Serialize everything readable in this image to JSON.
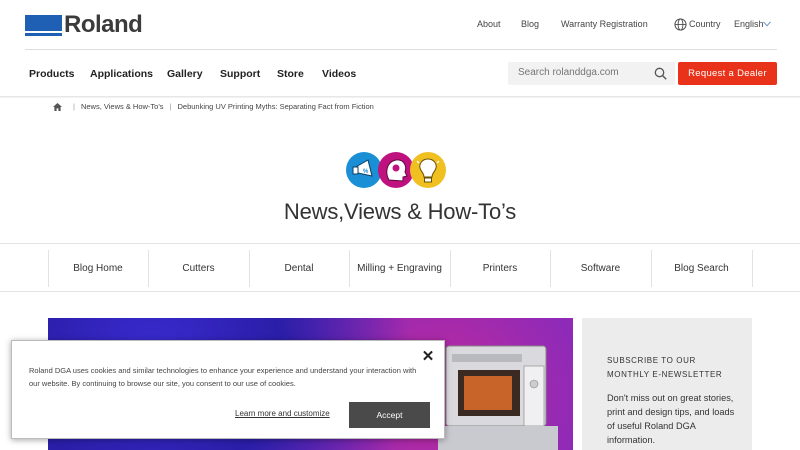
{
  "brand": {
    "name": "Roland",
    "color": "#1f5fb4"
  },
  "top_links": {
    "about": "About",
    "blog": "Blog",
    "warranty": "Warranty Registration",
    "country": "Country",
    "language": "English"
  },
  "nav": {
    "items": [
      "Products",
      "Applications",
      "Gallery",
      "Support",
      "Store",
      "Videos"
    ],
    "search_placeholder": "Search rolanddga.com",
    "dealer_button": "Request a Dealer",
    "dealer_color": "#e8331a"
  },
  "breadcrumb": {
    "items": [
      "News, Views & How-To's",
      "Debunking UV Printing Myths: Separating Fact from Fiction"
    ]
  },
  "hero": {
    "title": "News,Views & How-To’s",
    "icon_colors": [
      "#1b8fd6",
      "#c0127f",
      "#f0c020"
    ]
  },
  "categories": [
    "Blog Home",
    "Cutters",
    "Dental",
    "Milling + Engraving",
    "Printers",
    "Software",
    "Blog Search"
  ],
  "sidebar": {
    "heading": "SUBSCRIBE TO OUR MONTHLY E-NEWSLETTER",
    "body": "Don't miss out on great stories, print and design tips, and loads of useful Roland DGA information."
  },
  "cookie": {
    "text": "Roland DGA uses cookies and similar technologies to enhance your experience and understand your interaction with our website. By continuing to browse our site, you consent to our use of cookies.",
    "close": "✕",
    "learn_more": "Learn more and customize",
    "accept": "Accept"
  }
}
